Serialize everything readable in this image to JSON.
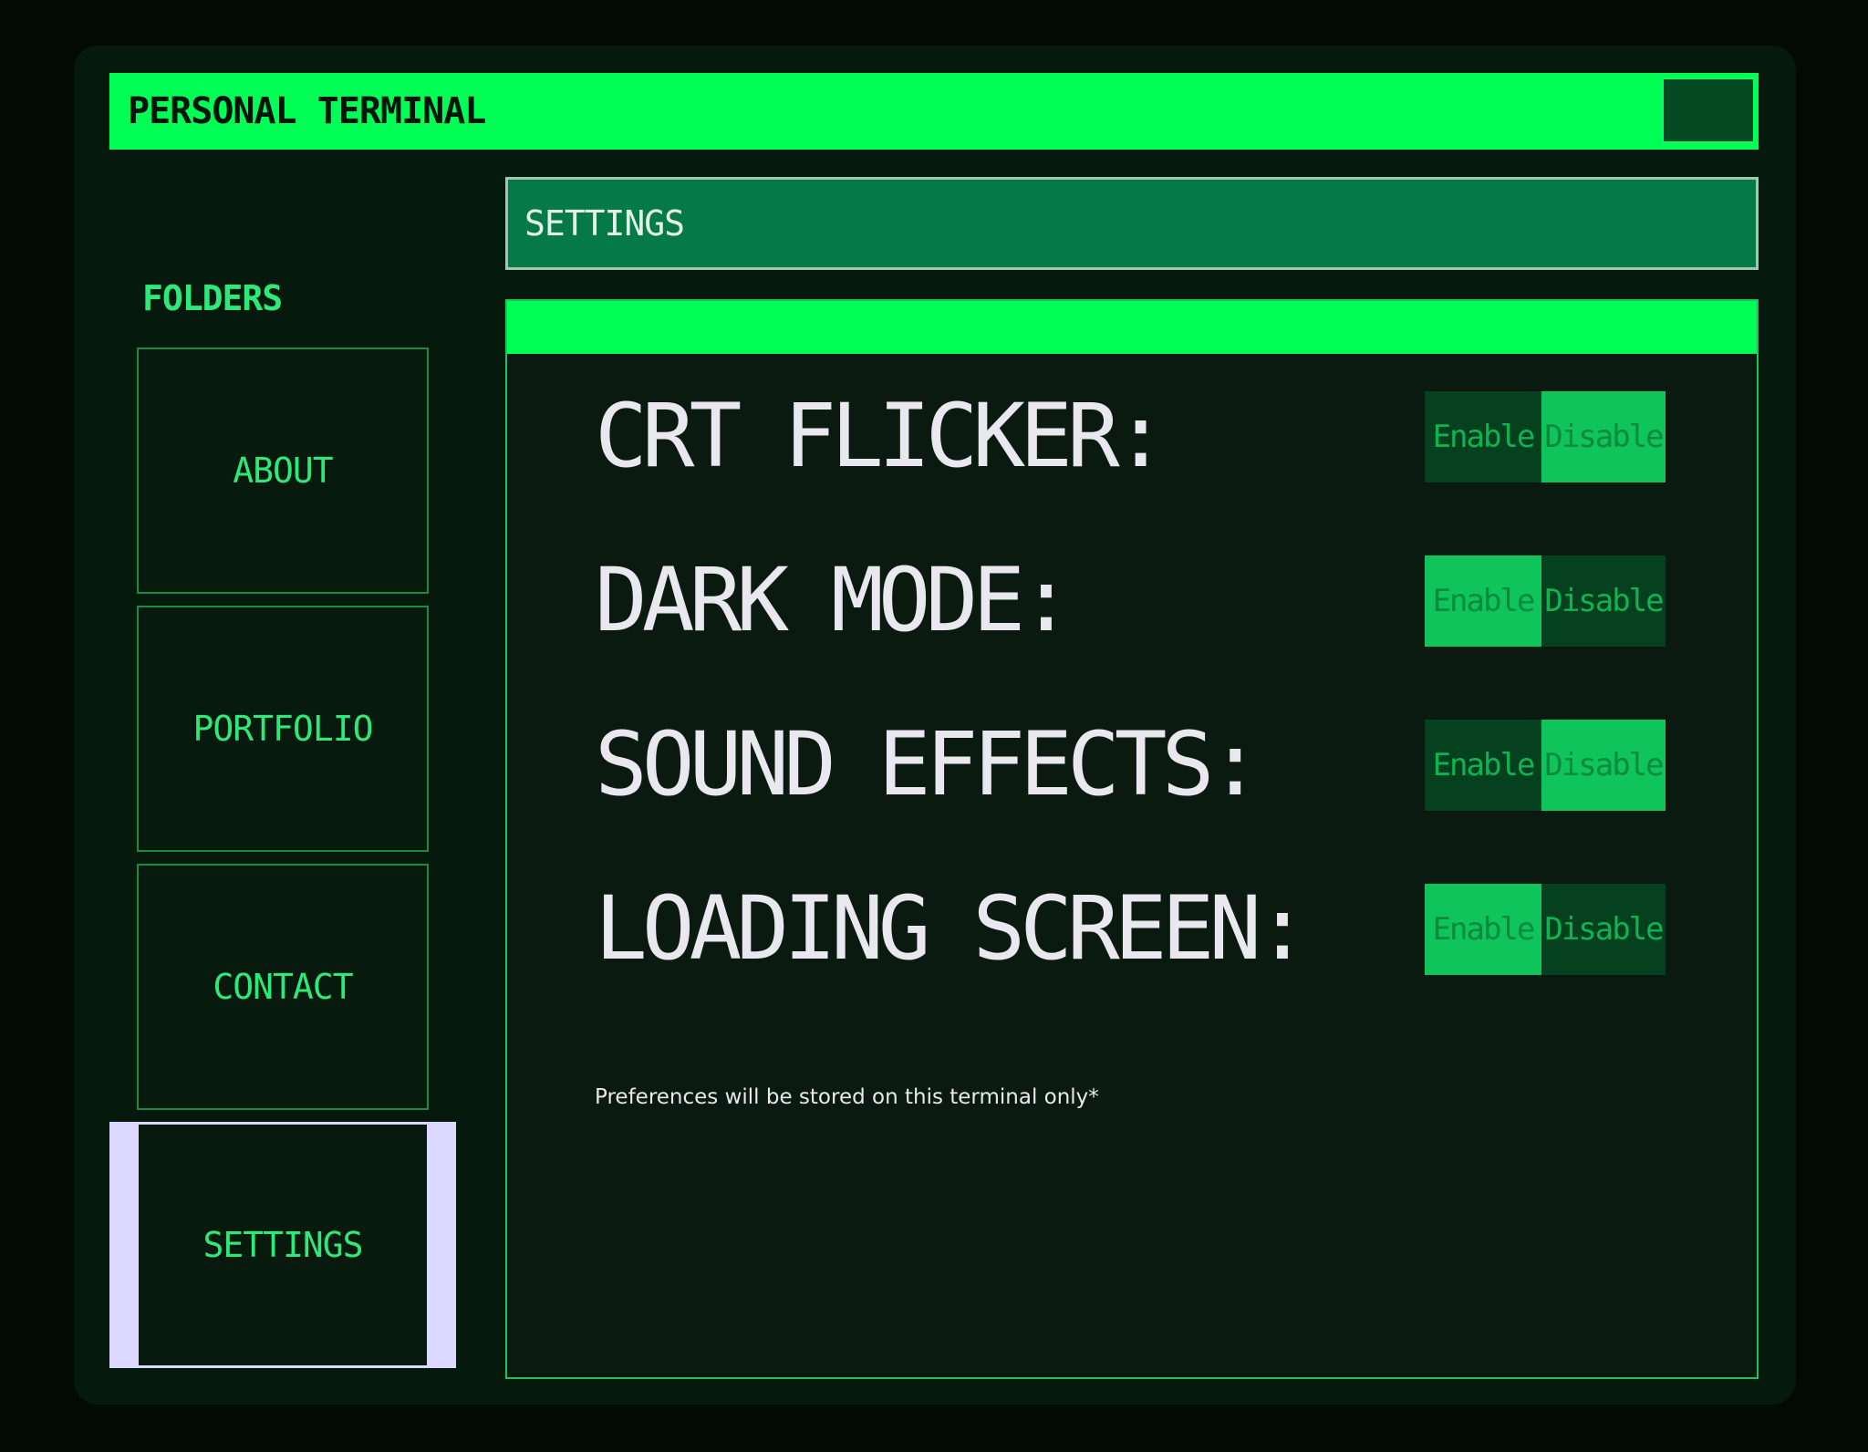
{
  "window": {
    "title": "PERSONAL TERMINAL"
  },
  "sidebar": {
    "label": "FOLDERS",
    "items": [
      {
        "label": "ABOUT"
      },
      {
        "label": "PORTFOLIO"
      },
      {
        "label": "CONTACT"
      },
      {
        "label": "SETTINGS",
        "active": true
      }
    ]
  },
  "header": {
    "title": "SETTINGS"
  },
  "settings": [
    {
      "label": "CRT FLICKER:",
      "enable": "Enable",
      "disable": "Disable",
      "selected": "Disable"
    },
    {
      "label": "DARK MODE:",
      "enable": "Enable",
      "disable": "Disable",
      "selected": "Enable"
    },
    {
      "label": "SOUND EFFECTS:",
      "enable": "Enable",
      "disable": "Disable",
      "selected": "Disable"
    },
    {
      "label": "LOADING SCREEN:",
      "enable": "Enable",
      "disable": "Disable",
      "selected": "Enable"
    }
  ],
  "note": "Preferences will be stored on this terminal only*",
  "colors": {
    "accent": "#00ff55",
    "text": "#e8e8ee",
    "folder_text": "#2ee87a",
    "active_folder_highlight": "#dcd8ff"
  }
}
